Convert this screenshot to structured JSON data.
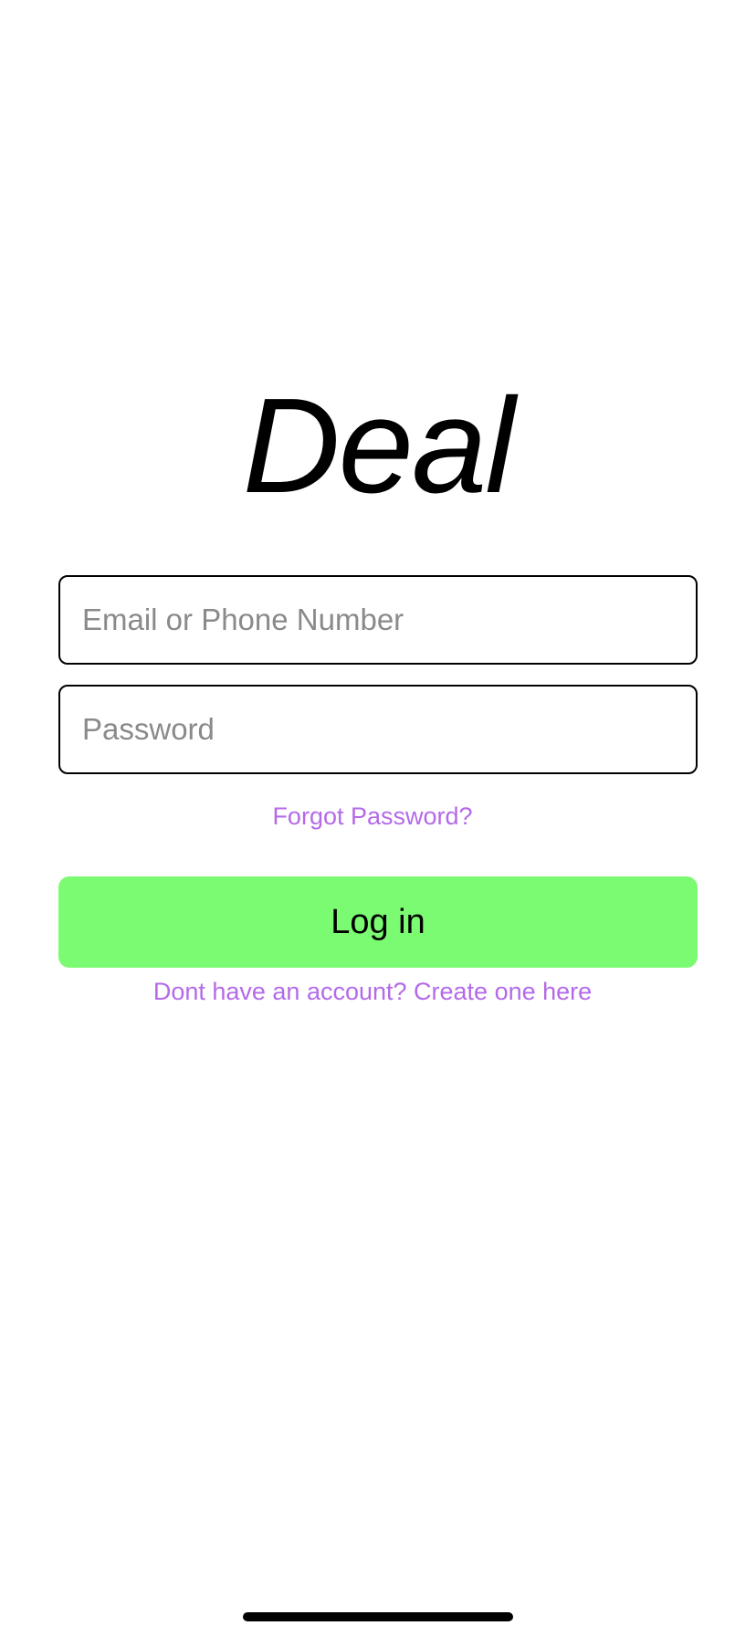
{
  "app": {
    "logo_text": "Deal"
  },
  "form": {
    "email": {
      "placeholder": "Email or Phone Number",
      "value": ""
    },
    "password": {
      "placeholder": "Password",
      "value": ""
    },
    "forgot_password_label": "Forgot Password?",
    "login_label": "Log in",
    "signup_label": "Dont have an account? Create one here"
  },
  "colors": {
    "link": "#b46ae8",
    "login_button": "#7bfb72",
    "field_border": "#000000",
    "placeholder": "#8a8a8a"
  }
}
